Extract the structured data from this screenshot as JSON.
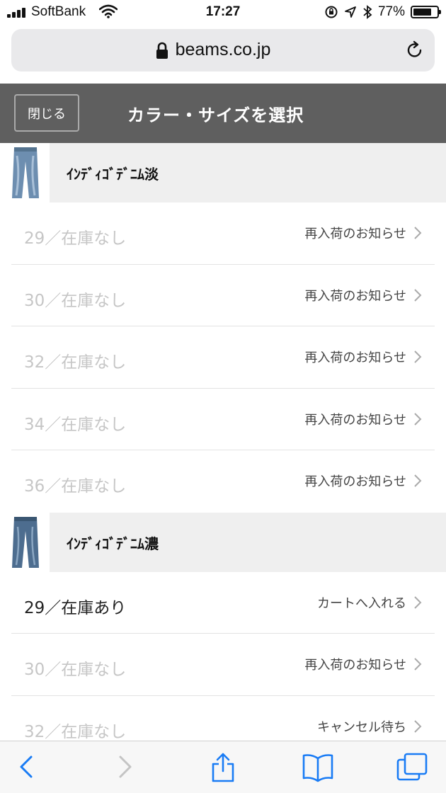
{
  "status_bar": {
    "carrier": "SoftBank",
    "time": "17:27",
    "battery_percent": "77%",
    "battery_level": 0.77,
    "icons": [
      "signal-icon",
      "wifi-icon",
      "orientation-lock-icon",
      "location-icon",
      "bluetooth-icon",
      "battery-icon"
    ]
  },
  "browser": {
    "url": "beams.co.jp",
    "icons": [
      "lock-icon",
      "reload-icon"
    ]
  },
  "header": {
    "close_label": "閉じる",
    "title": "カラー・サイズを選択"
  },
  "colors": [
    {
      "name": "ｲﾝﾃﾞｨｺﾞﾃﾞﾆﾑ淡",
      "sizes": [
        {
          "label": "29／在庫なし",
          "action": "再入荷のお知らせ",
          "in_stock": false
        },
        {
          "label": "30／在庫なし",
          "action": "再入荷のお知らせ",
          "in_stock": false
        },
        {
          "label": "32／在庫なし",
          "action": "再入荷のお知らせ",
          "in_stock": false
        },
        {
          "label": "34／在庫なし",
          "action": "再入荷のお知らせ",
          "in_stock": false
        },
        {
          "label": "36／在庫なし",
          "action": "再入荷のお知らせ",
          "in_stock": false
        }
      ]
    },
    {
      "name": "ｲﾝﾃﾞｨｺﾞﾃﾞﾆﾑ濃",
      "sizes": [
        {
          "label": "29／在庫あり",
          "action": "カートへ入れる",
          "in_stock": true
        },
        {
          "label": "30／在庫なし",
          "action": "再入荷のお知らせ",
          "in_stock": false
        },
        {
          "label": "32／在庫なし",
          "action": "キャンセル待ち",
          "in_stock": false
        }
      ]
    }
  ],
  "toolbar": {
    "icons": [
      "back-icon",
      "forward-icon",
      "share-icon",
      "bookmarks-icon",
      "tabs-icon"
    ]
  },
  "theme": {
    "header_bg": "#5f5f5f",
    "accent": "#1a7cf5",
    "out_of_stock_text": "#c6c6c6"
  }
}
